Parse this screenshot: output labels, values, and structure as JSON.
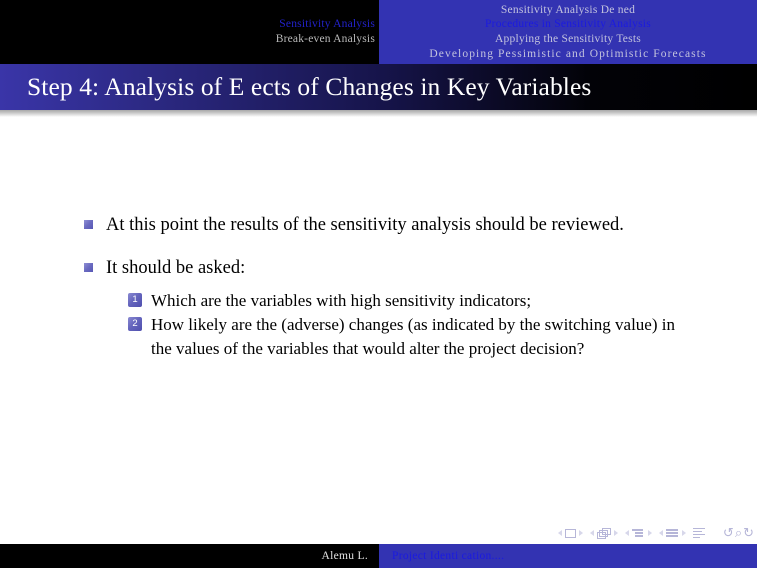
{
  "theme": {
    "header_dark": "#000000",
    "header_blue": "#3333b2",
    "accent_active": "#1a1ae0",
    "accent_inactive": "#c3c3de",
    "title_gradient_from": "#3a35a8",
    "title_gradient_to": "#000000",
    "bullet_color": "#6565bd",
    "body_text": "#000000",
    "slide_bg": "#ffffff"
  },
  "header": {
    "sections": [
      {
        "label": "Sensitivity Analysis",
        "active": true
      },
      {
        "label": "Break-even Analysis",
        "active": false
      }
    ],
    "subsections": [
      {
        "label": "Sensitivity Analysis De ned",
        "active": false
      },
      {
        "label": "Procedures in Sensitivity Analysis",
        "active": true
      },
      {
        "label": "Applying the Sensitivity Tests",
        "active": false
      },
      {
        "label": "Developing  Pessimistic  and  Optimistic  Forecasts",
        "active": false
      }
    ]
  },
  "title": {
    "text": "Step 4: Analysis of E ects of Changes in Key Variables"
  },
  "content": {
    "bullets": [
      {
        "text": "At this point the results of the sensitivity analysis should be reviewed.",
        "sub": []
      },
      {
        "text": "It should be asked:",
        "sub": [
          {
            "number": "1",
            "text": "Which are the variables with high sensitivity indicators;"
          },
          {
            "number": "2",
            "text": "How likely are the (adverse) changes (as indicated by the switching value) in the values of the variables that would alter the project decision?"
          }
        ]
      }
    ]
  },
  "nav_symbols": {
    "groups": [
      {
        "icon": "slide-icon",
        "prev": "◂",
        "next": "▸"
      },
      {
        "icon": "frames-icon",
        "prev": "◂",
        "next": "▸"
      },
      {
        "icon": "subsection-icon",
        "prev": "◂",
        "next": "▸"
      },
      {
        "icon": "section-icon",
        "prev": "◂",
        "next": "▸"
      }
    ],
    "document_icon": "document-icon",
    "back_icon": "↺",
    "search_icon": "⌕",
    "forward_icon": "↻"
  },
  "footer": {
    "author": "Alemu L.",
    "document": "Project Identi cation...."
  }
}
